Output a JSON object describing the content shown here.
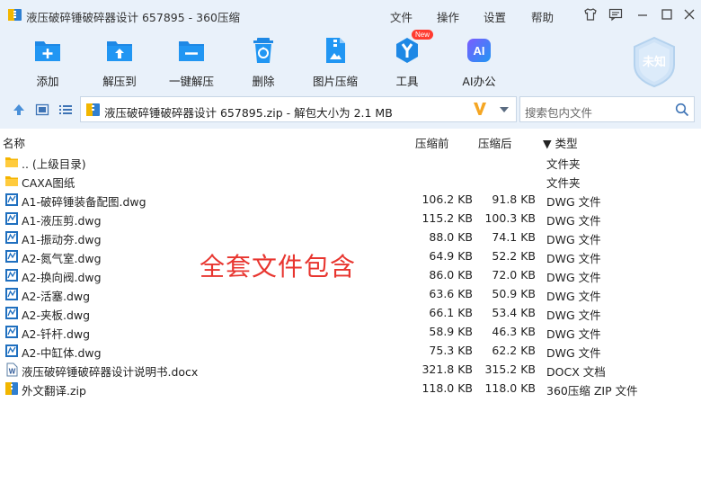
{
  "window": {
    "title": "液压破碎锤破碎器设计 657895 - 360压缩",
    "menu": [
      "文件",
      "操作",
      "设置",
      "帮助"
    ]
  },
  "toolbar": {
    "items": [
      {
        "label": "添加",
        "icon": "add-icon"
      },
      {
        "label": "解压到",
        "icon": "extract-to-icon"
      },
      {
        "label": "一键解压",
        "icon": "one-click-extract-icon"
      },
      {
        "label": "删除",
        "icon": "delete-icon"
      },
      {
        "label": "图片压缩",
        "icon": "image-compress-icon"
      },
      {
        "label": "工具",
        "icon": "tools-icon",
        "badge": "New"
      },
      {
        "label": "AI办公",
        "icon": "ai-office-icon"
      }
    ],
    "shield_label": "未知"
  },
  "address": {
    "path": "液压破碎锤破碎器设计 657895.zip - 解包大小为 2.1 MB",
    "search_placeholder": "搜索包内文件"
  },
  "columns": {
    "name": "名称",
    "packed": "压缩前",
    "size": "压缩后",
    "type": "▼ 类型"
  },
  "files": [
    {
      "name": ".. (上级目录)",
      "packed": "",
      "size": "",
      "type": "文件夹",
      "kind": "folder"
    },
    {
      "name": "CAXA图纸",
      "packed": "",
      "size": "",
      "type": "文件夹",
      "kind": "folder"
    },
    {
      "name": "A1-破碎锤装备配图.dwg",
      "packed": "106.2 KB",
      "size": "91.8 KB",
      "type": "DWG 文件",
      "kind": "dwg"
    },
    {
      "name": "A1-液压剪.dwg",
      "packed": "115.2 KB",
      "size": "100.3 KB",
      "type": "DWG 文件",
      "kind": "dwg"
    },
    {
      "name": "A1-振动夯.dwg",
      "packed": "88.0 KB",
      "size": "74.1 KB",
      "type": "DWG 文件",
      "kind": "dwg"
    },
    {
      "name": "A2-氮气室.dwg",
      "packed": "64.9 KB",
      "size": "52.2 KB",
      "type": "DWG 文件",
      "kind": "dwg"
    },
    {
      "name": "A2-换向阀.dwg",
      "packed": "86.0 KB",
      "size": "72.0 KB",
      "type": "DWG 文件",
      "kind": "dwg"
    },
    {
      "name": "A2-活塞.dwg",
      "packed": "63.6 KB",
      "size": "50.9 KB",
      "type": "DWG 文件",
      "kind": "dwg"
    },
    {
      "name": "A2-夹板.dwg",
      "packed": "66.1 KB",
      "size": "53.4 KB",
      "type": "DWG 文件",
      "kind": "dwg"
    },
    {
      "name": "A2-钎杆.dwg",
      "packed": "58.9 KB",
      "size": "46.3 KB",
      "type": "DWG 文件",
      "kind": "dwg"
    },
    {
      "name": "A2-中缸体.dwg",
      "packed": "75.3 KB",
      "size": "62.2 KB",
      "type": "DWG 文件",
      "kind": "dwg"
    },
    {
      "name": "液压破碎锤破碎器设计说明书.docx",
      "packed": "321.8 KB",
      "size": "315.2 KB",
      "type": "DOCX 文档",
      "kind": "docx"
    },
    {
      "name": "外文翻译.zip",
      "packed": "118.0 KB",
      "size": "118.0 KB",
      "type": "360压缩 ZIP 文件",
      "kind": "zip"
    }
  ],
  "overlay_text": "全套文件包含"
}
